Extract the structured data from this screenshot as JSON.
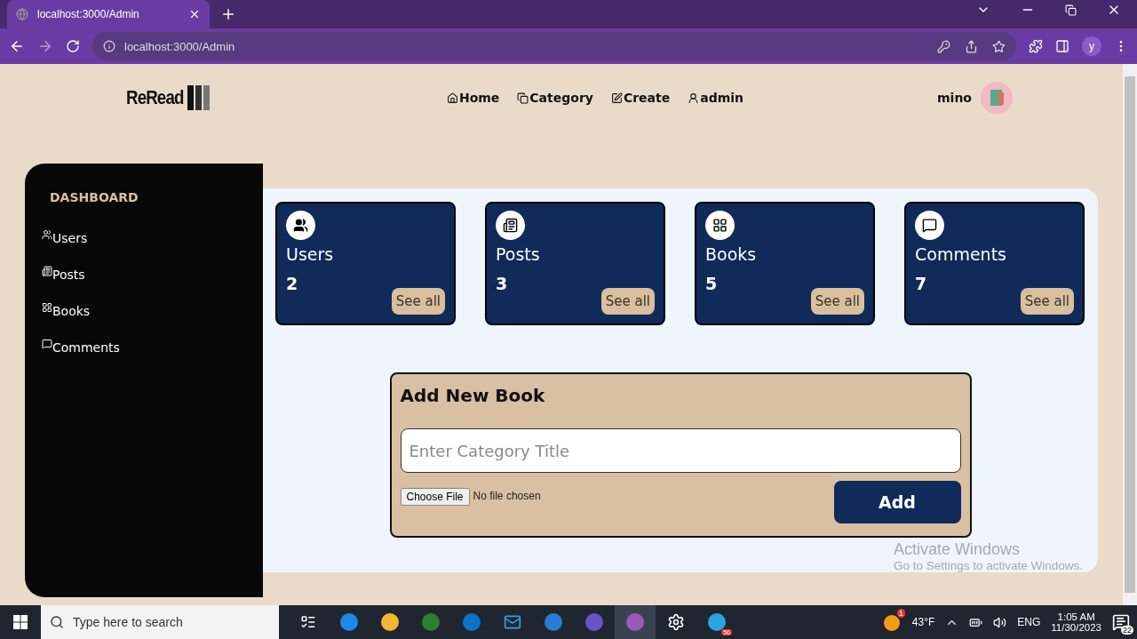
{
  "browser": {
    "tab_title": "localhost:3000/Admin",
    "url": "localhost:3000/Admin",
    "profile": "y"
  },
  "header": {
    "logo": "ReRead",
    "nav": [
      {
        "label": "Home"
      },
      {
        "label": "Category"
      },
      {
        "label": "Create"
      },
      {
        "label": "admin"
      }
    ],
    "user": "mino"
  },
  "sidebar": {
    "title": "DASHBOARD",
    "items": [
      {
        "label": "Users"
      },
      {
        "label": "Posts"
      },
      {
        "label": "Books"
      },
      {
        "label": "Comments"
      }
    ]
  },
  "stats": [
    {
      "title": "Users",
      "count": "2",
      "button": "See all"
    },
    {
      "title": "Posts",
      "count": "3",
      "button": "See all"
    },
    {
      "title": "Books",
      "count": "5",
      "button": "See all"
    },
    {
      "title": "Comments",
      "count": "7",
      "button": "See all"
    }
  ],
  "form": {
    "title": "Add New Book",
    "placeholder": "Enter Category Title",
    "file_button": "Choose File",
    "file_status": "No file chosen",
    "submit": "Add"
  },
  "activation": {
    "title": "Activate Windows",
    "subtitle": "Go to Settings to activate Windows."
  },
  "taskbar": {
    "search_placeholder": "Type here to search",
    "telegram_badge": "56",
    "weather_badge": "1",
    "temperature": "43°F",
    "language": "ENG",
    "time": "1:05 AM",
    "date": "11/30/2023",
    "notifications": "22"
  }
}
